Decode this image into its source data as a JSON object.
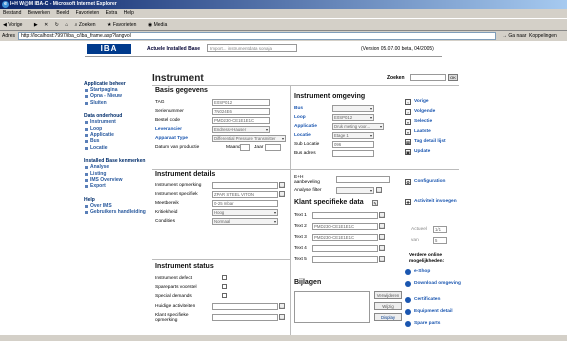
{
  "window": {
    "title": "I+H W@M IBA-C - Microsoft Internet Explorer"
  },
  "menu": [
    "Bestand",
    "Bewerken",
    "Beeld",
    "Favorieten",
    "Extra",
    "Help"
  ],
  "toolbar": [
    "Vorige",
    "Zoeken",
    "Favorieten",
    "Media"
  ],
  "address": {
    "label": "Adres",
    "url": "http://localhost:7997/iba_c/iba_frame.asp?langvol",
    "go": "Ga naar",
    "links": "Koppelingen"
  },
  "header": {
    "logo": "IBA",
    "app_name": "Actuele Installed Base",
    "app_tag": "Import... instrumentdata sonaja",
    "version": "(Version 05.07.00 beta, 04/2005)"
  },
  "sidebar": [
    {
      "title": "Applicatie beheer",
      "items": [
        "Startpagina",
        "Opna - Nieuw",
        "Sluiten"
      ]
    },
    {
      "title": "Data onderhoud",
      "items": [
        "Instrument",
        "Loop",
        "Applicatie",
        "Bus",
        "Locatie"
      ]
    },
    {
      "title": "Installed Base kenmerken",
      "items": [
        "Analyse",
        "Listing",
        "IMS Overview",
        "Export"
      ]
    },
    {
      "title": "Help",
      "items": [
        "Over IMS",
        "Gebruikers handleiding"
      ]
    }
  ],
  "main": {
    "title": "Instrument",
    "search_label": "Zoeken",
    "search_ok": "OK",
    "basis": {
      "title": "Basis gegevens",
      "tag_label": "TAG",
      "tag_value": "E0SP012",
      "serial_label": "Serienummer",
      "serial_value": "7N024E6",
      "order_label": "Bestel code",
      "order_value": "PMD230-CE1E1E1C",
      "supplier_label": "Leverancier",
      "supplier_value": "Endress+Hauser",
      "type_label": "Apparaat Type",
      "type_value": "Differential Pressure Transmitter",
      "date_label": "Datum van productie",
      "month_label": "Maand",
      "year_label": "Jaar"
    },
    "omgeving": {
      "title": "Instrument omgeving",
      "bus_label": "Bus",
      "bus_value": "",
      "loop_label": "Loop",
      "loop_value": "E0SP012",
      "app_label": "Applicatie",
      "app_value": "Druk meting voor...",
      "loc_label": "Locatie",
      "loc_value": "Etage 1",
      "subloc_label": "Sub Locatie",
      "subloc_value": "096",
      "busadr_label": "Bus adres",
      "busadr_value": ""
    },
    "details": {
      "title": "Instrument details",
      "desc_label": "Instrument opmerking",
      "desc_value": "",
      "spec_label": "Instrument specifiek",
      "spec_value": "ZPAR STEEL VITON",
      "range_label": "Meetbereik",
      "range_value": "0-25 mbar",
      "priority_label": "Kritiekheid",
      "priority_value": "Hoog",
      "cond_label": "Condities",
      "cond_value": "Normaal"
    },
    "eh": {
      "rec_label": "E+H aanbeveling",
      "rec_value": "",
      "filter_label": "Analyse filter",
      "filter_value": ""
    },
    "klant": {
      "title": "Klant specifieke data",
      "fields": [
        {
          "label": "Text 1",
          "value": ""
        },
        {
          "label": "Text 2",
          "value": "PMD230-CE1E1E1C"
        },
        {
          "label": "Text 3",
          "value": "PMD230-CE1E1E1C"
        },
        {
          "label": "Text 4",
          "value": ""
        },
        {
          "label": "Text 5",
          "value": ""
        }
      ]
    },
    "status": {
      "title": "Instrument status",
      "defect_label": "Instrument defect",
      "spare_label": "Spareparts voorstel",
      "special_label": "Special demands",
      "current_label": "Huidige activiteiten",
      "remark_label": "Klant specifieke opmerking"
    },
    "bijlagen": {
      "title": "Bijlagen",
      "delete_btn": "Verwijderen",
      "change_btn": "Wijzig",
      "display_btn": "Display"
    }
  },
  "right": {
    "nav": [
      "Vorige",
      "Volgende",
      "Selectie",
      "Laatste",
      "Tag detail lijst",
      "Update"
    ],
    "config": "Configuration",
    "kit": "Activiteit invoegen",
    "actual_label": "Actueel",
    "actual_value": "1/1",
    "van_label": "van",
    "van_value": "5",
    "online_title": "Verdere online mogelijkheden:",
    "online": [
      "e-Shop",
      "Download omgeving",
      "Certificaten",
      "Equipment detail",
      "Spare parts"
    ]
  }
}
